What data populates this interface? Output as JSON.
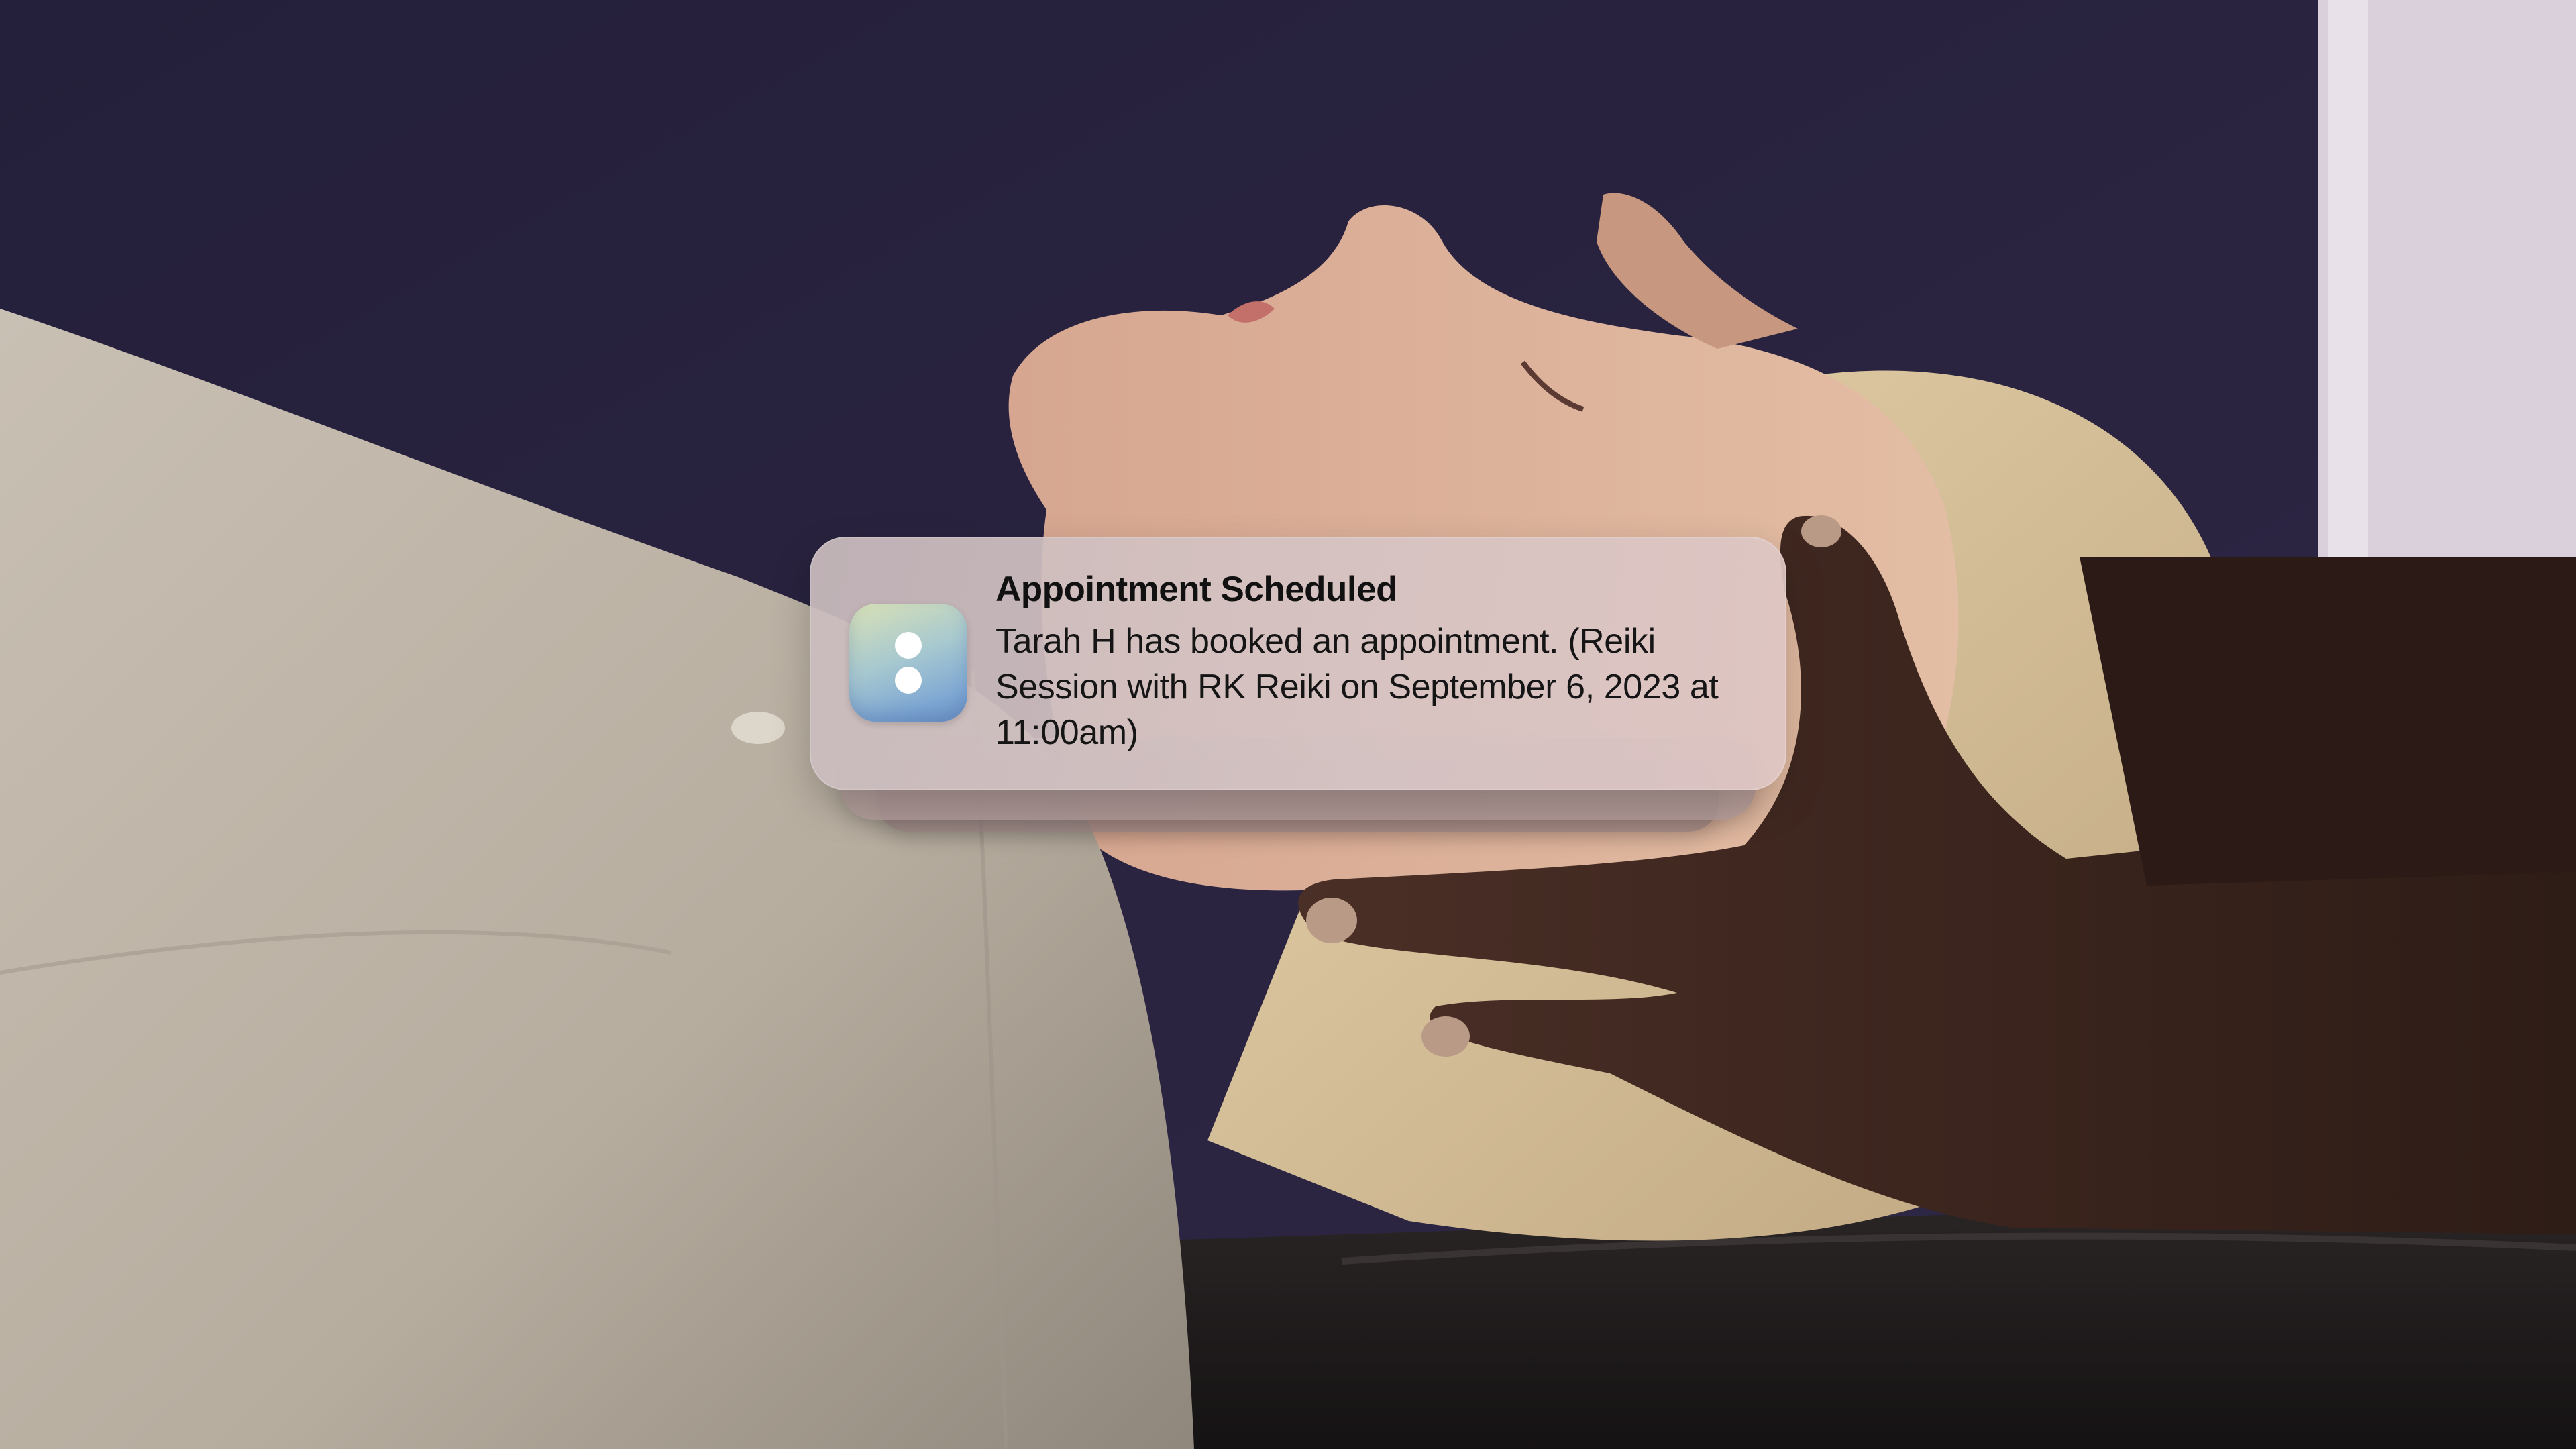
{
  "notification": {
    "app_icon": "app-logo-two-dots-icon",
    "title": "Appointment Scheduled",
    "body": "Tarah H has booked an appointment. (Reiki Session with RK Reiki on September 6, 2023 at 11:00am)"
  },
  "colors": {
    "backdrop": "#2a2440",
    "card": "#d2c0c0",
    "title_text": "#111111",
    "body_text": "#151515",
    "icon_gradient_top": "#d9e1b6",
    "icon_gradient_bottom": "#6f96c8"
  }
}
